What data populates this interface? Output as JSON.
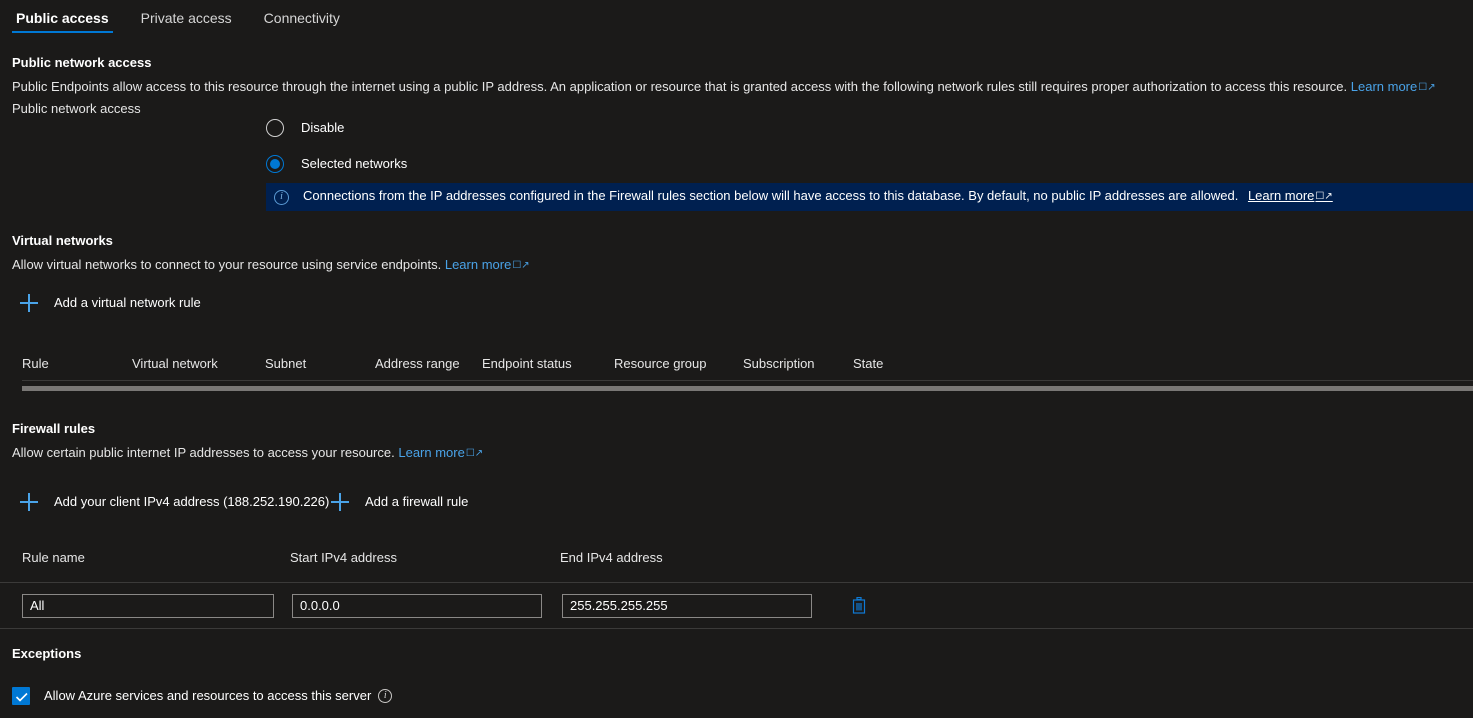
{
  "tabs": [
    {
      "label": "Public access",
      "active": true
    },
    {
      "label": "Private access",
      "active": false
    },
    {
      "label": "Connectivity",
      "active": false
    }
  ],
  "public_network_access": {
    "heading": "Public network access",
    "description": "Public Endpoints allow access to this resource through the internet using a public IP address. An application or resource that is granted access with the following network rules still requires proper authorization to access this resource.",
    "description_link": "Learn more",
    "field_label": "Public network access",
    "options": [
      {
        "label": "Disable",
        "selected": false
      },
      {
        "label": "Selected networks",
        "selected": true
      }
    ],
    "info_banner": {
      "icon": "info-icon",
      "text": "Connections from the IP addresses configured in the Firewall rules section below will have access to this database. By default, no public IP addresses are allowed.",
      "link": "Learn more",
      "background": "#002050"
    }
  },
  "virtual_networks": {
    "heading": "Virtual networks",
    "description": "Allow virtual networks to connect to your resource using service endpoints.",
    "description_link": "Learn more",
    "add_rule_label": "Add a virtual network rule",
    "columns": [
      "Rule",
      "Virtual network",
      "Subnet",
      "Address range",
      "Endpoint status",
      "Resource group",
      "Subscription",
      "State"
    ],
    "rows": []
  },
  "firewall_rules": {
    "heading": "Firewall rules",
    "description": "Allow certain public internet IP addresses to access your resource.",
    "description_link": "Learn more",
    "add_client_ip_label": "Add your client IPv4 address (188.252.190.226)",
    "add_firewall_rule_label": "Add a firewall rule",
    "columns": {
      "rule_name": "Rule name",
      "start_ip": "Start IPv4 address",
      "end_ip": "End IPv4 address"
    },
    "rows": [
      {
        "rule_name": "All",
        "start_ip": "0.0.0.0",
        "end_ip": "255.255.255.255",
        "delete_icon": "trash-icon"
      }
    ]
  },
  "exceptions": {
    "heading": "Exceptions",
    "allow_azure_services": {
      "label": "Allow Azure services and resources to access this server",
      "checked": true,
      "info_icon": "info-icon"
    }
  },
  "colors": {
    "background": "#1b1a19",
    "accent": "#0078d4",
    "link": "#4aa3e8",
    "banner_bg": "#002050",
    "divider": "#3b3a39"
  }
}
